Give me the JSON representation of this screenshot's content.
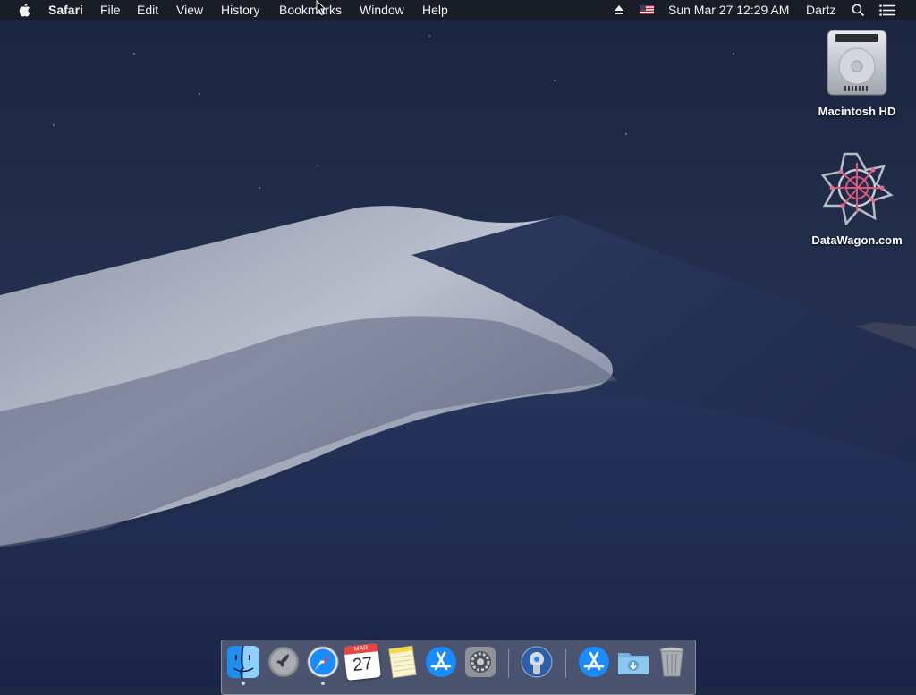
{
  "menubar": {
    "app_name": "Safari",
    "menus": [
      "File",
      "Edit",
      "View",
      "History",
      "Bookmarks",
      "Window",
      "Help"
    ],
    "datetime": "Sun Mar 27  12:29 AM",
    "user": "Dartz"
  },
  "desktop_icons": [
    {
      "label": "Macintosh HD",
      "icon": "hard-drive-icon"
    },
    {
      "label": "DataWagon.com",
      "icon": "datawagon-logo-icon"
    }
  ],
  "dock": {
    "calendar_month": "MAR",
    "calendar_day": "27",
    "items": [
      "finder-icon",
      "launchpad-icon",
      "safari-icon",
      "calendar-icon",
      "notes-icon",
      "app-store-icon",
      "system-preferences-icon",
      "network-utility-icon",
      "app-store-icon",
      "downloads-folder-icon",
      "trash-icon"
    ]
  },
  "colors": {
    "menubar_bg": "#181c26",
    "sky": "#1d2742",
    "dune_light": "#c5cad6",
    "accent_blue": "#1a8cff"
  }
}
